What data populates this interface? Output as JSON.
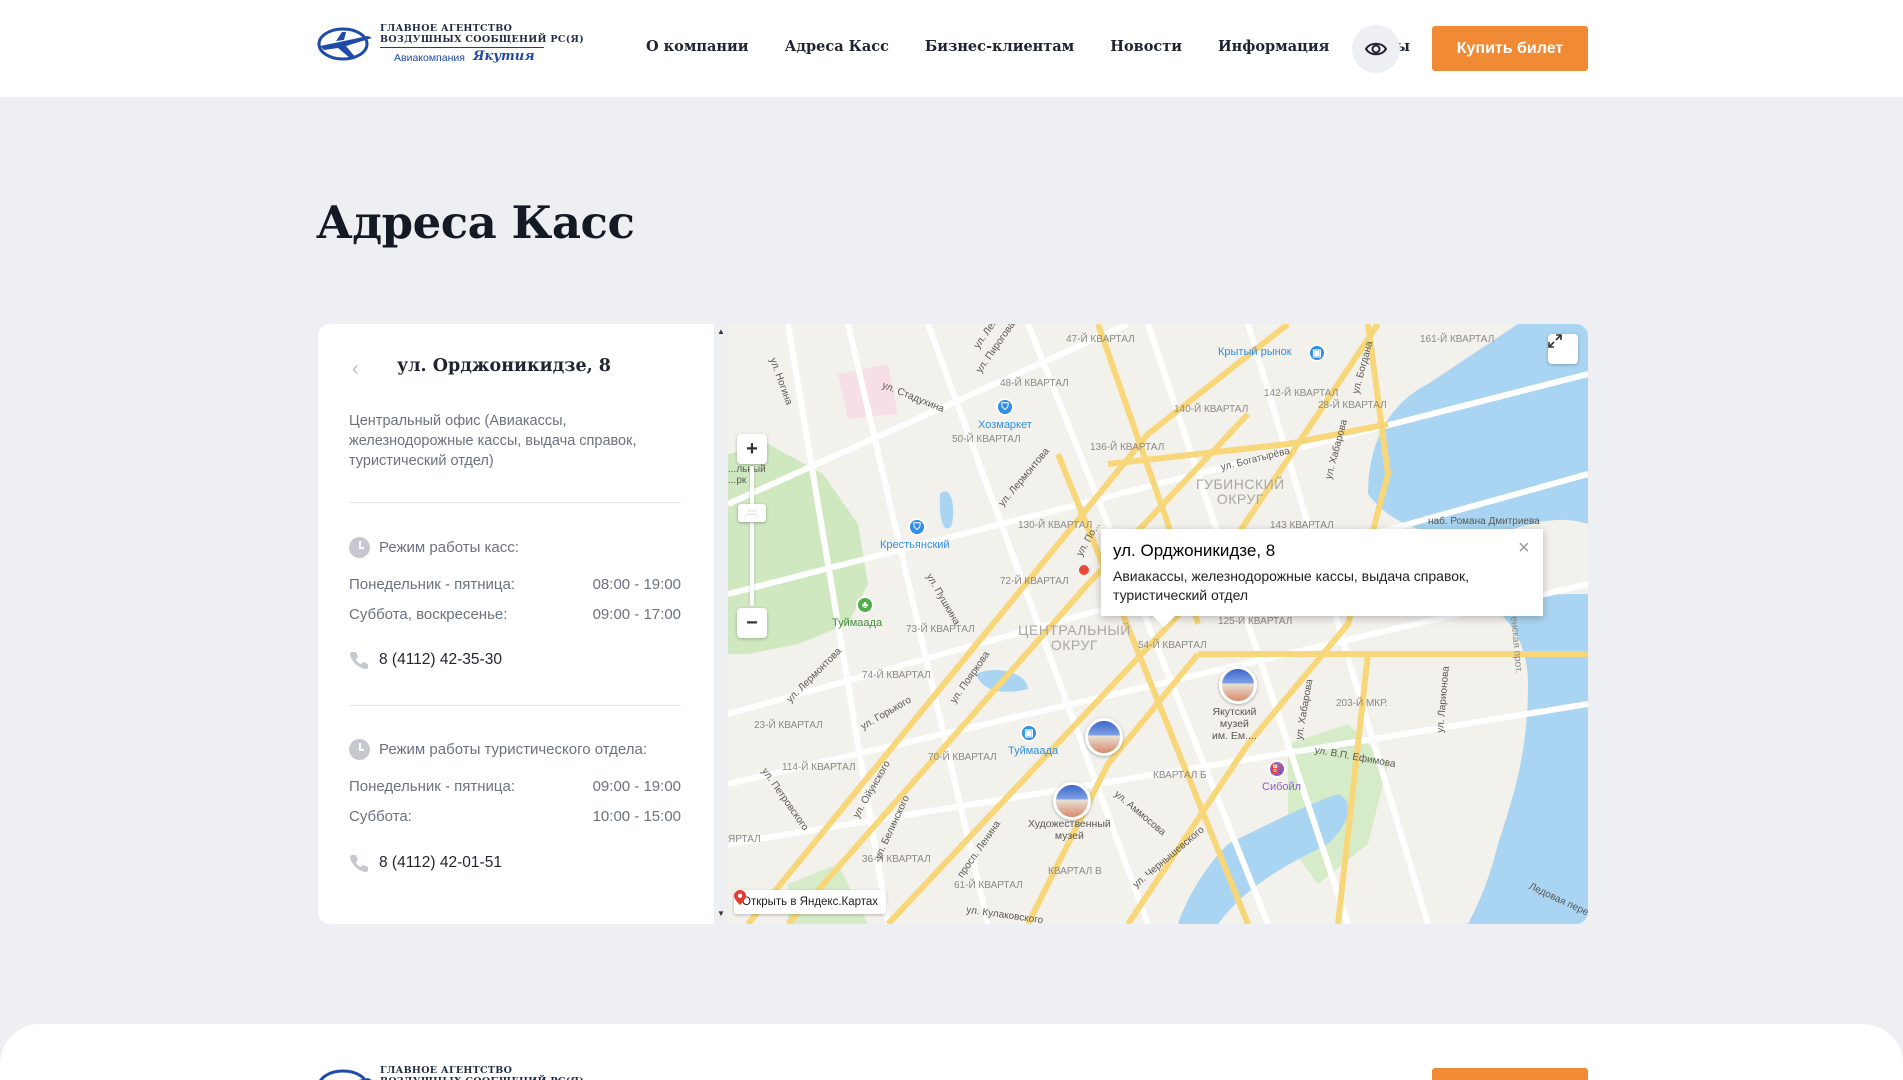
{
  "header": {
    "logo": {
      "line1": "ГЛАВНОЕ АГЕНТСТВО",
      "line2": "ВОЗДУШНЫХ СООБЩЕНИЙ РС(Я)",
      "line3": "Авиакомпания",
      "script": "Якутия"
    },
    "nav": [
      {
        "label": "О компании"
      },
      {
        "label": "Адреса Касс"
      },
      {
        "label": "Бизнес-клиентам"
      },
      {
        "label": "Новости"
      },
      {
        "label": "Информация"
      },
      {
        "label": "Туры"
      }
    ],
    "accessibility_icon": "eye-icon",
    "buy_label": "Купить билет",
    "buy_color": "#f08a35"
  },
  "page": {
    "title": "Адреса Касс"
  },
  "office": {
    "title": "ул. Орджоникидзе, 8",
    "description": "Центральный офис (Авиакассы, железнодорожные кассы, выдача справок, туристический отдел)",
    "cashier": {
      "heading": "Режим работы касс:",
      "rows": [
        {
          "days": "Понедельник - пятница:",
          "time": "08:00 - 19:00"
        },
        {
          "days": "Суббота, воскресенье:",
          "time": "09:00 - 17:00"
        }
      ],
      "phone": "8 (4112) 42-35-30"
    },
    "tourism": {
      "heading": "Режим работы туристического отдела:",
      "rows": [
        {
          "days": "Понедельник - пятница:",
          "time": "09:00 - 19:00"
        },
        {
          "days": "Суббота:",
          "time": "10:00 - 15:00"
        }
      ],
      "phone": "8 (4112) 42-01-51"
    }
  },
  "map": {
    "balloon": {
      "title": "ул. Орджоникидзе, 8",
      "text": "Авиакассы, железнодорожные кассы, выдача справок, туристический отдел"
    },
    "open_link": "Открыть в Яндекс.Картах",
    "zoom_in": "+",
    "zoom_out": "−",
    "districts": {
      "central_1": "ЦЕНТРАЛЬНЫЙ",
      "central_2": "ОКРУГ",
      "gubinsky_1": "ГУБИНСКИЙ",
      "gubinsky_2": "ОКРУГ"
    },
    "streets": {
      "s1": "ул. Стадухина",
      "s2": "ул. Пирогова",
      "s3": "ул. Ногина",
      "s4": "ул. Лермонтова",
      "s5": "ул. Богатырёва",
      "s6": "ул. Хабарова",
      "s7": "ул. Богдана",
      "s8": "ул. Пушкина",
      "s9": "ул. Пояркова",
      "s10": "ул. Лермонтова",
      "s11": "ул. Горького",
      "s12": "ул. Петровского",
      "s13": "ул. Ойунского",
      "s14": "ул. Белинского",
      "s15": "просп. Ленина",
      "s16": "ул. Аммосова",
      "s17": "ул. Чернышевского",
      "s18": "ул. Кулаковского",
      "s19": "ул. Ларионова",
      "s20": "ул. В.П. Ефимова",
      "s21": "наб. Романа Дмитриева",
      "s22": "ул. Хабарова",
      "s23": "ул. Лена",
      "s24": "Ледовая пере...",
      "s25": "Ленская прот.",
      "s26": "ул. По...",
      "s27": "...льный\n...рк"
    },
    "quarters": {
      "q1": "47-Й КВАРТАЛ",
      "q2": "48-Й КВАРТАЛ",
      "q3": "50-Й КВАРТАЛ",
      "q4": "136-Й КВАРТАЛ",
      "q5": "140-Й КВАРТАЛ",
      "q6": "142-Й КВАРТАЛ",
      "q7": "28-Й КВАРТАЛ",
      "q8": "161-Й КВАРТАЛ",
      "q9": "130-Й КВАРТАЛ",
      "q10": "143 КВАРТАЛ",
      "q11": "72-Й КВАРТАЛ",
      "q12": "73-Й КВАРТАЛ",
      "q13": "125-Й КВАРТАЛ",
      "q14": "54-Й КВАРТАЛ",
      "q15": "74-Й КВАРТАЛ",
      "q16": "23-Й КВАРТАЛ",
      "q17": "114-Й КВАРТАЛ",
      "q18": "70-Й КВАРТАЛ",
      "q19": "КВАРТАЛ Б",
      "q20": "КВАРТАЛ В",
      "q21": "36-Й КВАРТАЛ",
      "q22": "61-Й КВАРТАЛ",
      "q23": "203-Й МКР.",
      "q24": "ЯРТАЛ"
    },
    "pois": {
      "p1": "Крытый рынок",
      "p2": "Хозмаркет",
      "p3": "Крестьянский",
      "p4": "Туймаада",
      "p5": "Туймаада",
      "p6": "Якутский\nмузей\nим. Ем....",
      "p7": "Сибойл",
      "p8": "Художественный\nмузей"
    },
    "colors": {
      "road_major": "#f8d77a",
      "water": "#a9d5f2",
      "park": "#cfe8c0"
    }
  }
}
